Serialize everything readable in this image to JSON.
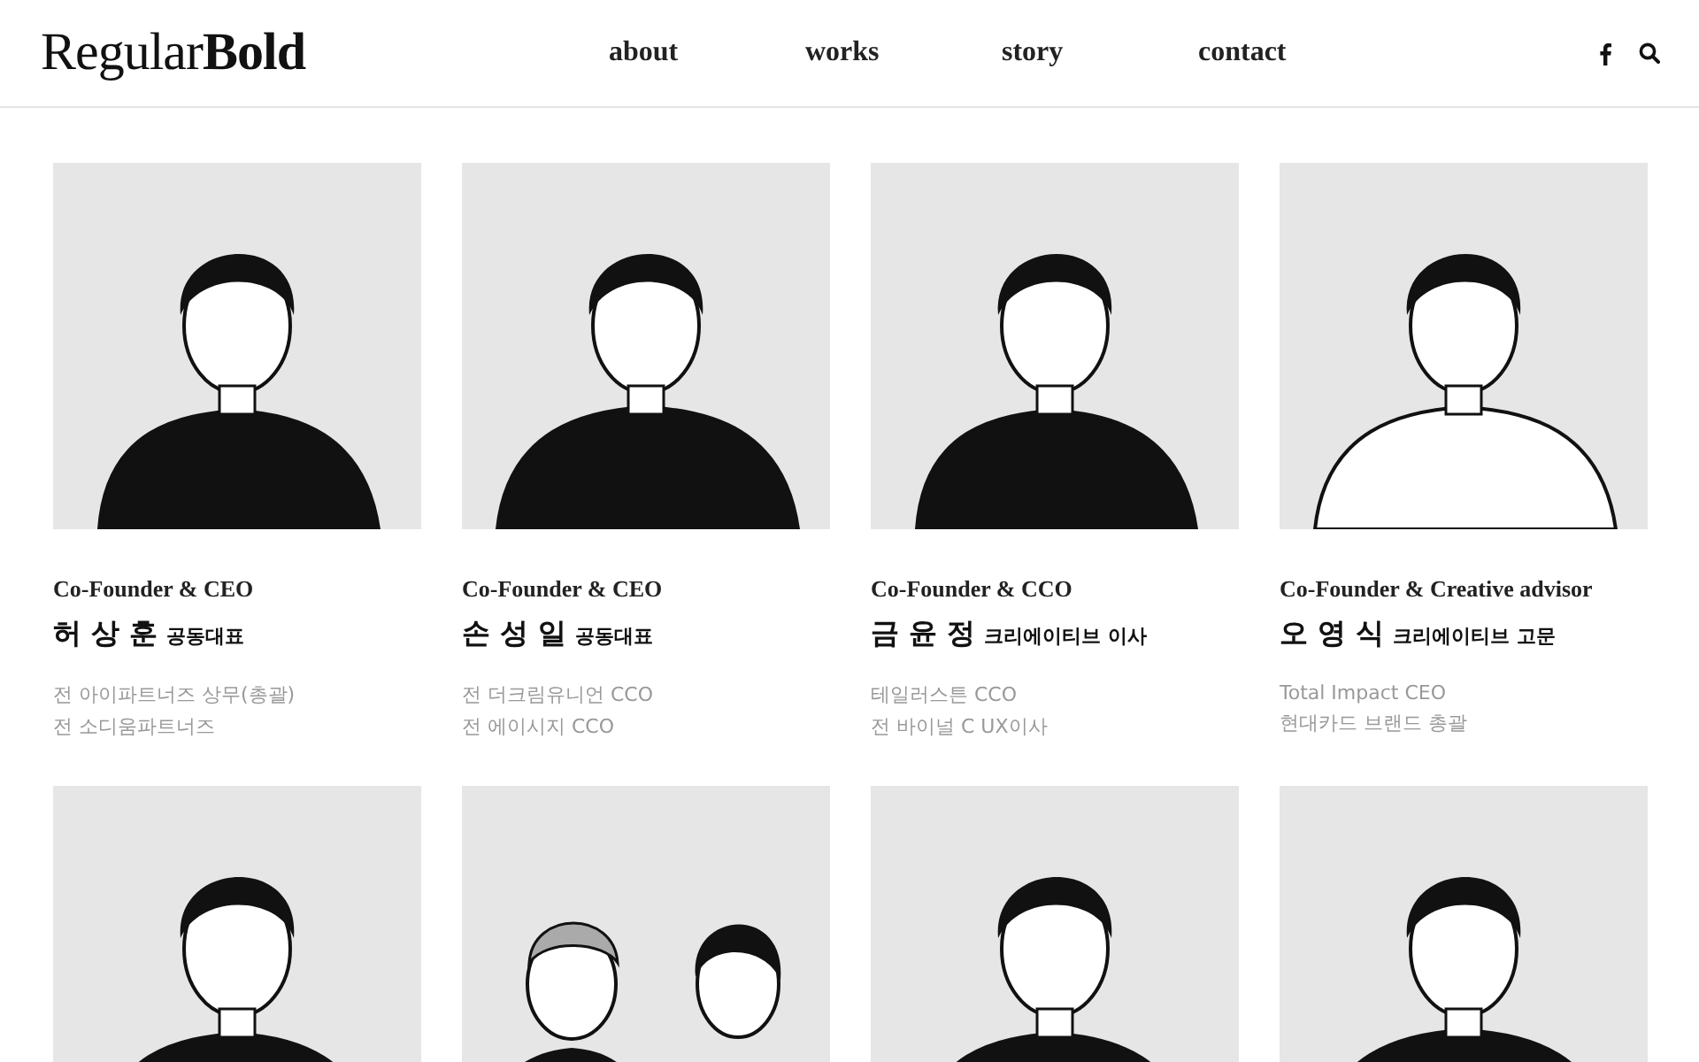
{
  "logo": "Regular**Bold**",
  "nav": [
    {
      "label": "about",
      "selected": false
    },
    {
      "label": "works",
      "selected": false
    },
    {
      "label": "story",
      "selected": false
    },
    {
      "label": "contact",
      "selected": false
    }
  ],
  "members": [
    {
      "kind": "profile",
      "title": "Co-Founder & CEO",
      "name": "허 상 훈",
      "role": "공동대표",
      "bio": [
        "전 아이파트너즈 상무(총괄)",
        "전 소디움파트너즈"
      ]
    },
    {
      "kind": "profile",
      "title": "Co-Founder & CEO",
      "name": "손 성 일",
      "role": "공동대표",
      "bio": [
        "전 더크림유니언 CCO",
        "전 에이시지 CCO"
      ]
    },
    {
      "kind": "profile",
      "title": "Co-Founder & CCO",
      "name": "금 윤 정",
      "role": "크리에이티브 이사",
      "bio": [
        "테일러스튼 CCO",
        "전 바이널 C UX이사"
      ]
    },
    {
      "kind": "profile",
      "title": "Co-Founder & Creative advisor",
      "name": "오 영 식",
      "role": "크리에이티브 고문",
      "bio": [
        "Total Impact CEO",
        "현대카드 브랜드 총괄"
      ]
    },
    {
      "kind": "picture"
    },
    {
      "kind": "picture"
    },
    {
      "kind": "picture"
    },
    {
      "kind": "picture"
    }
  ]
}
